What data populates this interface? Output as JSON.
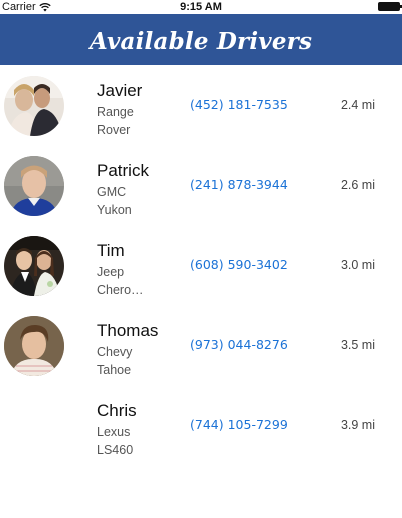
{
  "status_bar": {
    "carrier": "Carrier",
    "time": "9:15 AM"
  },
  "nav": {
    "title": "Available Drivers"
  },
  "drivers": [
    {
      "name": "Javier",
      "vehicle_line1": "Range",
      "vehicle_line2": "Rover",
      "phone": "(452) 181-7535",
      "distance": "2.4 mi",
      "has_photo": true
    },
    {
      "name": "Patrick",
      "vehicle_line1": "GMC",
      "vehicle_line2": "Yukon",
      "phone": "(241) 878-3944",
      "distance": "2.6 mi",
      "has_photo": true
    },
    {
      "name": "Tim",
      "vehicle_line1": "Jeep",
      "vehicle_line2": "Chero…",
      "phone": "(608) 590-3402",
      "distance": "3.0 mi",
      "has_photo": true
    },
    {
      "name": "Thomas",
      "vehicle_line1": "Chevy",
      "vehicle_line2": "Tahoe",
      "phone": "(973) 044-8276",
      "distance": "3.5 mi",
      "has_photo": true
    },
    {
      "name": "Chris",
      "vehicle_line1": "Lexus",
      "vehicle_line2": "LS460",
      "phone": "(744) 105-7299",
      "distance": "3.9 mi",
      "has_photo": false
    }
  ],
  "colors": {
    "nav_background": "#2f5597",
    "phone_link": "#1b72d6"
  }
}
